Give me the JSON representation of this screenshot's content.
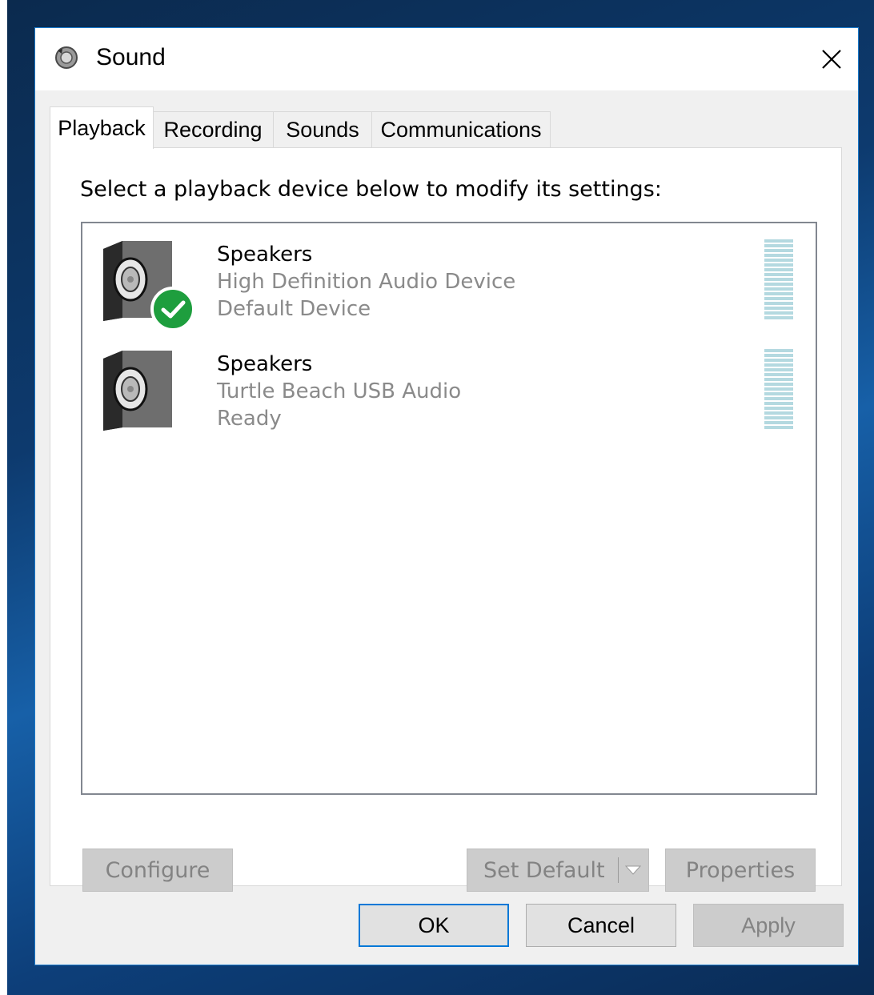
{
  "window": {
    "title": "Sound"
  },
  "tabs": [
    {
      "label": "Playback",
      "active": true
    },
    {
      "label": "Recording",
      "active": false
    },
    {
      "label": "Sounds",
      "active": false
    },
    {
      "label": "Communications",
      "active": false
    }
  ],
  "playback": {
    "instruction": "Select a playback device below to modify its settings:",
    "devices": [
      {
        "name": "Speakers",
        "description": "High Definition Audio Device",
        "status": "Default Device",
        "is_default": true,
        "icon": "speaker-icon"
      },
      {
        "name": "Speakers",
        "description": "Turtle Beach USB Audio",
        "status": "Ready",
        "is_default": false,
        "icon": "speaker-icon"
      }
    ],
    "buttons": {
      "configure": "Configure",
      "set_default": "Set Default",
      "properties": "Properties"
    }
  },
  "footer": {
    "ok": "OK",
    "cancel": "Cancel",
    "apply": "Apply"
  },
  "colors": {
    "accent": "#0078d7",
    "default_badge": "#1e9e3e",
    "meter": "#b4d9e0"
  }
}
